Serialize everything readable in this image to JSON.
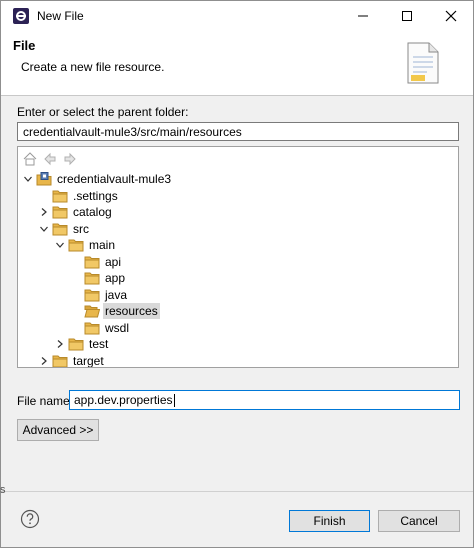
{
  "window": {
    "title": "New File",
    "icon": "eclipse-icon"
  },
  "header": {
    "title": "File",
    "description": "Create a new file resource.",
    "icon": "new-file-banner-icon"
  },
  "parent": {
    "label": "Enter or select the parent folder:",
    "value": "credentialvault-mule3/src/main/resources"
  },
  "tree": {
    "toolbar": [
      "home-icon",
      "back-icon",
      "forward-icon"
    ],
    "items": [
      {
        "label": "credentialvault-mule3",
        "depth": 0,
        "twisty": "expanded",
        "icon": "project-icon"
      },
      {
        "label": ".settings",
        "depth": 1,
        "twisty": "none",
        "icon": "folder-icon"
      },
      {
        "label": "catalog",
        "depth": 1,
        "twisty": "collapsed",
        "icon": "folder-icon"
      },
      {
        "label": "src",
        "depth": 1,
        "twisty": "expanded",
        "icon": "folder-icon"
      },
      {
        "label": "main",
        "depth": 2,
        "twisty": "expanded",
        "icon": "folder-icon"
      },
      {
        "label": "api",
        "depth": 3,
        "twisty": "none",
        "icon": "folder-icon"
      },
      {
        "label": "app",
        "depth": 3,
        "twisty": "none",
        "icon": "folder-icon"
      },
      {
        "label": "java",
        "depth": 3,
        "twisty": "none",
        "icon": "folder-icon"
      },
      {
        "label": "resources",
        "depth": 3,
        "twisty": "none",
        "icon": "folder-open-icon",
        "selected": true
      },
      {
        "label": "wsdl",
        "depth": 3,
        "twisty": "none",
        "icon": "folder-icon"
      },
      {
        "label": "test",
        "depth": 2,
        "twisty": "collapsed",
        "icon": "folder-icon"
      },
      {
        "label": "target",
        "depth": 1,
        "twisty": "collapsed",
        "icon": "folder-icon"
      }
    ]
  },
  "file_name": {
    "label": "File name:",
    "value": "app.dev.properties"
  },
  "buttons": {
    "advanced": "Advanced >>",
    "finish": "Finish",
    "cancel": "Cancel"
  },
  "edge_marks": {
    "left_lower": "s"
  },
  "colors": {
    "accent": "#0078d7",
    "folder": "#e8b64a",
    "selection": "#d9d9d9"
  }
}
